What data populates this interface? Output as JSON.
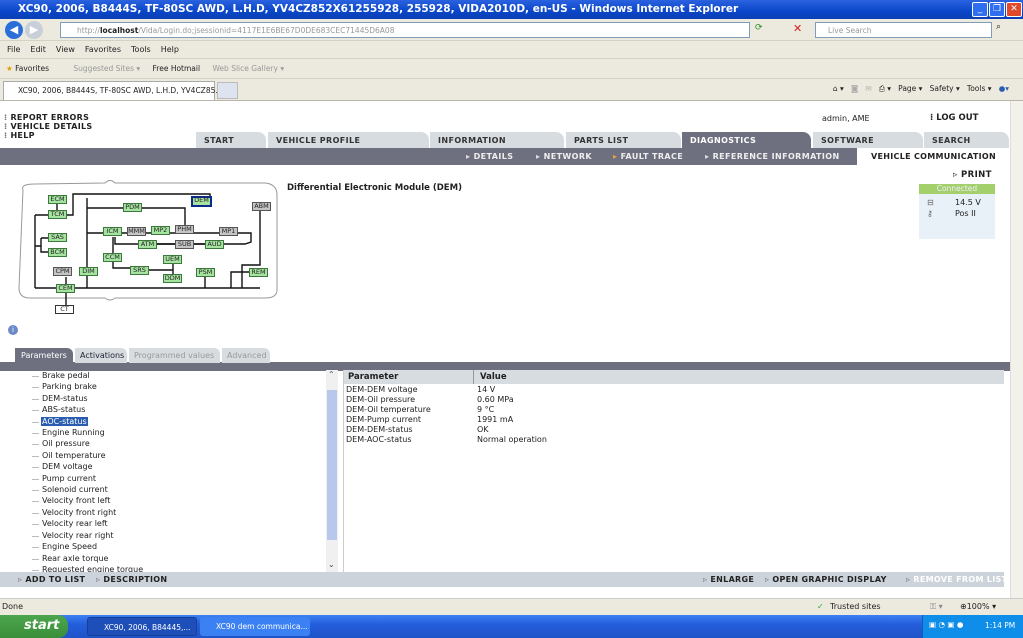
{
  "window": {
    "title": "XC90, 2006, B8444S, TF-80SC AWD, L.H.D, YV4CZ852X61255928, 255928, VIDA2010D, en-US - Windows Internet Explorer"
  },
  "browser": {
    "url_host": "localhost",
    "url_prefix": "http://",
    "url_rest": "/Vida/Login.do;jsessionid=4117E1E6BE67D0DE683CEC71445D6A08",
    "search_placeholder": "Live Search",
    "menu": [
      "File",
      "Edit",
      "View",
      "Favorites",
      "Tools",
      "Help"
    ],
    "favorites": {
      "label": "Favorites",
      "items": [
        "Suggested Sites ▾",
        "Free Hotmail",
        "Web Slice Gallery ▾"
      ]
    },
    "tab_title": "XC90, 2006, B8444S, TF-80SC AWD, L.H.D, YV4CZ85...",
    "commands": [
      "Page ▾",
      "Safety ▾",
      "Tools ▾"
    ],
    "status": "Done",
    "zone": "Trusted sites",
    "zoom": "100%"
  },
  "app": {
    "links": [
      "REPORT ERRORS",
      "VEHICLE DETAILS",
      "HELP"
    ],
    "user": "admin, AME",
    "logout": "LOG OUT",
    "tabs": [
      "START",
      "VEHICLE PROFILE",
      "INFORMATION",
      "PARTS LIST",
      "DIAGNOSTICS",
      "SOFTWARE",
      "SEARCH"
    ],
    "active_tab": "DIAGNOSTICS",
    "subnav": [
      "DETAILS",
      "NETWORK",
      "FAULT TRACE",
      "REFERENCE INFORMATION",
      "VEHICLE COMMUNICATION"
    ],
    "module_title": "Differential Electronic Module (DEM)",
    "print": "PRINT",
    "connection": {
      "status": "Connected",
      "voltage": "14.5 V",
      "ignition": "Pos II",
      "color": "#a4d06c"
    },
    "modules": [
      "ECM",
      "TCM",
      "SAS",
      "BCM",
      "CPM",
      "CEM",
      "CT",
      "DIM",
      "PDM",
      "DEM",
      "ABM",
      "ICM",
      "MMM",
      "MP2",
      "PHM",
      "MP1",
      "ATM",
      "SUB",
      "AUD",
      "CCM",
      "UEM",
      "SRS",
      "DDM",
      "PSM",
      "REM"
    ],
    "param_tabs": [
      "Parameters",
      "Activations",
      "Programmed values",
      "Advanced"
    ],
    "param_list": [
      "Brake pedal",
      "Parking brake",
      "DEM-status",
      "ABS-status",
      "AOC-status",
      "Engine Running",
      "Oil pressure",
      "Oil temperature",
      "DEM voltage",
      "Pump current",
      "Solenoid current",
      "Velocity front left",
      "Velocity front right",
      "Velocity rear left",
      "Velocity rear right",
      "Engine Speed",
      "Rear axle torque",
      "Requested engine torque"
    ],
    "selected_param": "AOC-status",
    "table": {
      "headers": [
        "Parameter",
        "Value"
      ],
      "rows": [
        [
          "DEM-DEM voltage",
          "14 V"
        ],
        [
          "DEM-Oil pressure",
          "0.60 MPa"
        ],
        [
          "DEM-Oil temperature",
          "9 °C"
        ],
        [
          "DEM-Pump current",
          "1991 mA"
        ],
        [
          "DEM-DEM-status",
          "OK"
        ],
        [
          "DEM-AOC-status",
          "Normal operation"
        ]
      ]
    },
    "bottom_actions": [
      "ADD TO LIST",
      "DESCRIPTION",
      "ENLARGE",
      "OPEN GRAPHIC DISPLAY",
      "REMOVE FROM LIST"
    ]
  },
  "taskbar": {
    "start": "start",
    "tasks": [
      "XC90, 2006, B84445,...",
      "XC90 dem communica..."
    ],
    "clock": "1:14 PM"
  }
}
